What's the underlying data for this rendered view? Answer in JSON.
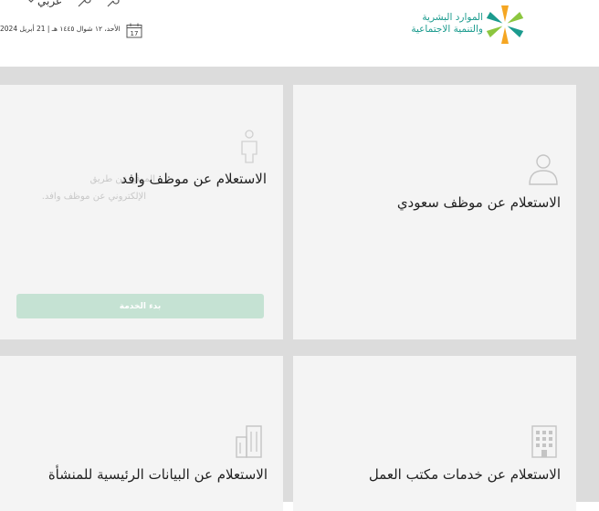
{
  "header": {
    "logo_line1": "الموارد البشرية",
    "logo_line2": "والتنمية الاجتماعية",
    "language_label": "عربي",
    "date": "الأحد، ١٢ شوال ١٤٤٥ هـ | 21 أبريل 2024",
    "calendar_day": "17"
  },
  "cards": [
    {
      "title": "الاستعلام عن موظف سعودي",
      "icon": "person-icon"
    },
    {
      "title": "الاستعلام عن موظف وافد",
      "icon": "worker-icon",
      "description_line1": "الموقع   عن   طريق",
      "description_line2": "الإلكتروني عن موظف وافد.",
      "button_label": "بدء الخدمة"
    },
    {
      "title": "الاستعلام عن خدمات مكتب العمل",
      "icon": "building-icon"
    },
    {
      "title": "الاستعلام عن البيانات الرئيسية للمنشأة",
      "icon": "buildings-icon"
    }
  ],
  "colors": {
    "brand_teal": "#1b9b8e",
    "button_green_faded": "#c5e2d3",
    "card_background": "#f4f4f4",
    "page_gray": "#dcdcdc"
  }
}
